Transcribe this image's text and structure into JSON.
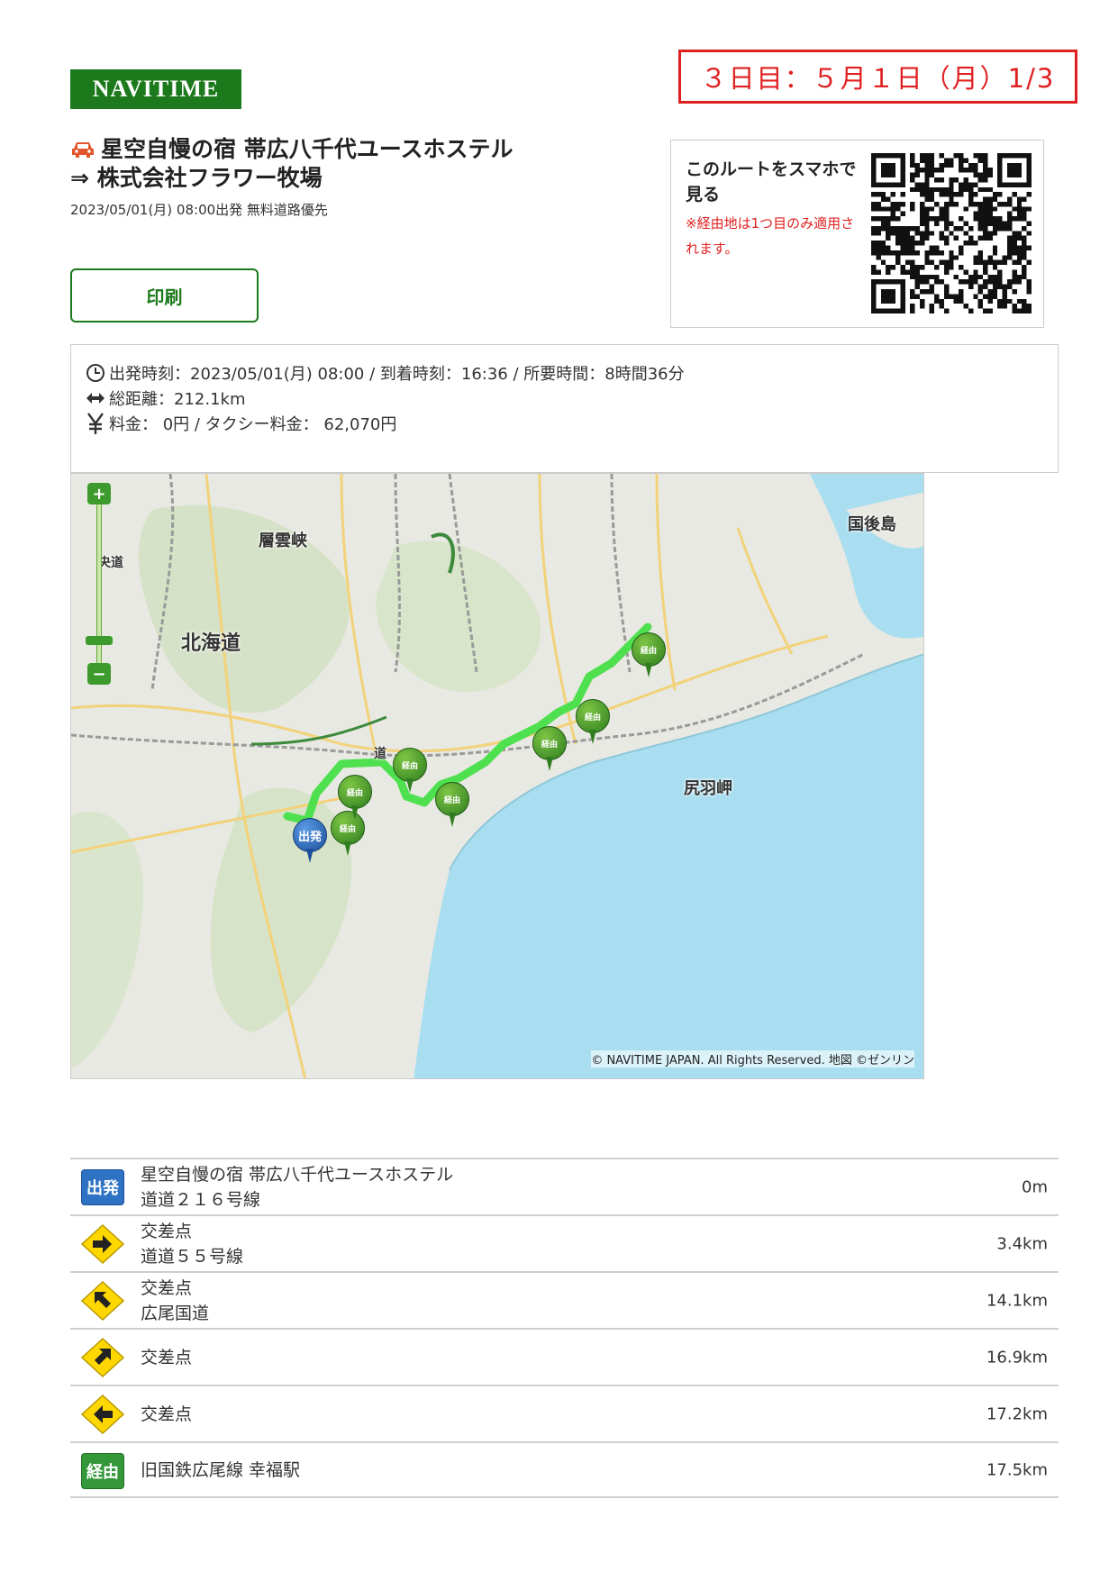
{
  "header": {
    "logo": "NAVITIME",
    "day_label": "３日目：５月１日（月）1/3"
  },
  "route": {
    "title_line1": "星空自慢の宿 帯広八千代ユースホステル",
    "title_line2": "⇒ 株式会社フラワー牧場",
    "subtitle": "2023/05/01(月) 08:00出発 無料道路優先"
  },
  "actions": {
    "print_label": "印刷"
  },
  "qr": {
    "title": "このルートをスマホで見る",
    "note": "※経由地は1つ目のみ適用されます。"
  },
  "summary": {
    "times": "出発時刻：2023/05/01(月) 08:00 / 到着時刻：16:36 / 所要時間：8時間36分",
    "distance": "総距離：212.1km",
    "fare": "料金： 0円 / タクシー料金： 62,070円"
  },
  "map": {
    "labels": {
      "sounkyo": "層雲峡",
      "hokkaido": "北海道",
      "kunashiri": "国後島",
      "shiriba": "尻羽岬",
      "chuo": "央道",
      "do": "道"
    },
    "pin_start": "出発",
    "pin_via": "経由",
    "copyright": "© NAVITIME JAPAN. All Rights Reserved. 地図 ©ゼンリン",
    "zoom_in": "+",
    "zoom_out": "−"
  },
  "steps": [
    {
      "icon": "start-badge",
      "badge": "出発",
      "line1": "星空自慢の宿 帯広八千代ユースホステル",
      "line2": "道道２１６号線",
      "distance": "0m"
    },
    {
      "icon": "turn-right-icon",
      "line1": "交差点",
      "line2": "道道５５号線",
      "distance": "3.4km"
    },
    {
      "icon": "turn-left-up-icon",
      "line1": "交差点",
      "line2": "広尾国道",
      "distance": "14.1km"
    },
    {
      "icon": "turn-right-up-icon",
      "line1": "交差点",
      "line2": "",
      "distance": "16.9km"
    },
    {
      "icon": "turn-left-icon",
      "line1": "交差点",
      "line2": "",
      "distance": "17.2km"
    },
    {
      "icon": "via-badge",
      "badge": "経由",
      "line1": "旧国鉄広尾線 幸福駅",
      "line2": "",
      "distance": "17.5km"
    }
  ],
  "colors": {
    "brand_green": "#1c7a1c",
    "alert_red": "#e02020",
    "route_green": "#4ee04e",
    "start_blue": "#2e72c4"
  }
}
